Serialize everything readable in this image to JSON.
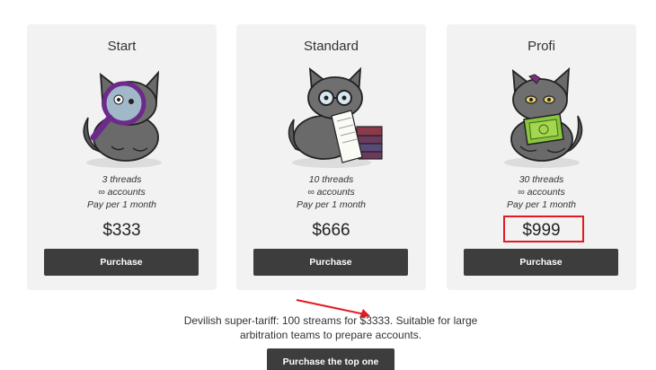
{
  "plans": [
    {
      "title": "Start",
      "features": [
        "3 threads",
        "∞ accounts",
        "Pay per 1 month"
      ],
      "price": "$333",
      "button_label": "Purchase",
      "icon": "cat-with-magnifier-icon"
    },
    {
      "title": "Standard",
      "features": [
        "10 threads",
        "∞ accounts",
        "Pay per 1 month"
      ],
      "price": "$666",
      "button_label": "Purchase",
      "icon": "cat-with-glasses-and-books-icon"
    },
    {
      "title": "Profi",
      "features": [
        "30 threads",
        "∞ accounts",
        "Pay per 1 month"
      ],
      "price": "$999",
      "button_label": "Purchase",
      "icon": "cat-with-money-icon",
      "highlighted": true
    }
  ],
  "tagline": {
    "line1": "Devilish super-tariff: 100 streams for $3333. Suitable for large",
    "line2": "arbitration teams to prepare accounts."
  },
  "top_button_label": "Purchase the top one",
  "colors": {
    "card_bg": "#f2f2f2",
    "button_bg": "#3d3d3d",
    "highlight": "#e21b23",
    "annotation_arrow": "#e21b23"
  }
}
